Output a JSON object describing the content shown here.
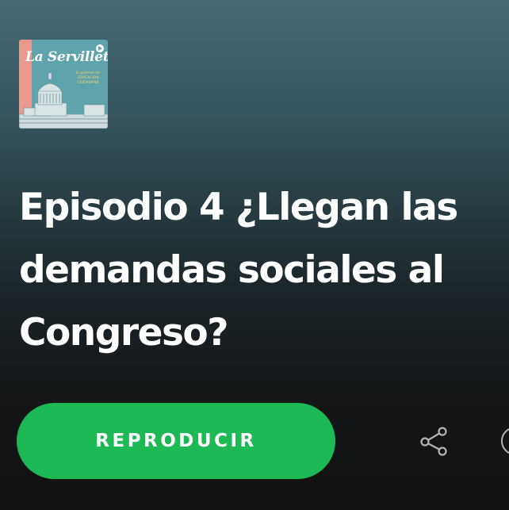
{
  "podcast": {
    "cover_title": "La Servilleta",
    "cover_subtitle": "El podcast de EDUCACIÓN CIUDADANA"
  },
  "episode": {
    "title": "Episodio 4 ¿Llegan las demandas sociales al Congreso?"
  },
  "actions": {
    "play_label": "REPRODUCIR"
  },
  "colors": {
    "accent": "#1db954",
    "background_top": "#466a73",
    "background_bottom": "#121212"
  },
  "icons": {
    "share": "share-icon",
    "more": "more-options-icon"
  }
}
